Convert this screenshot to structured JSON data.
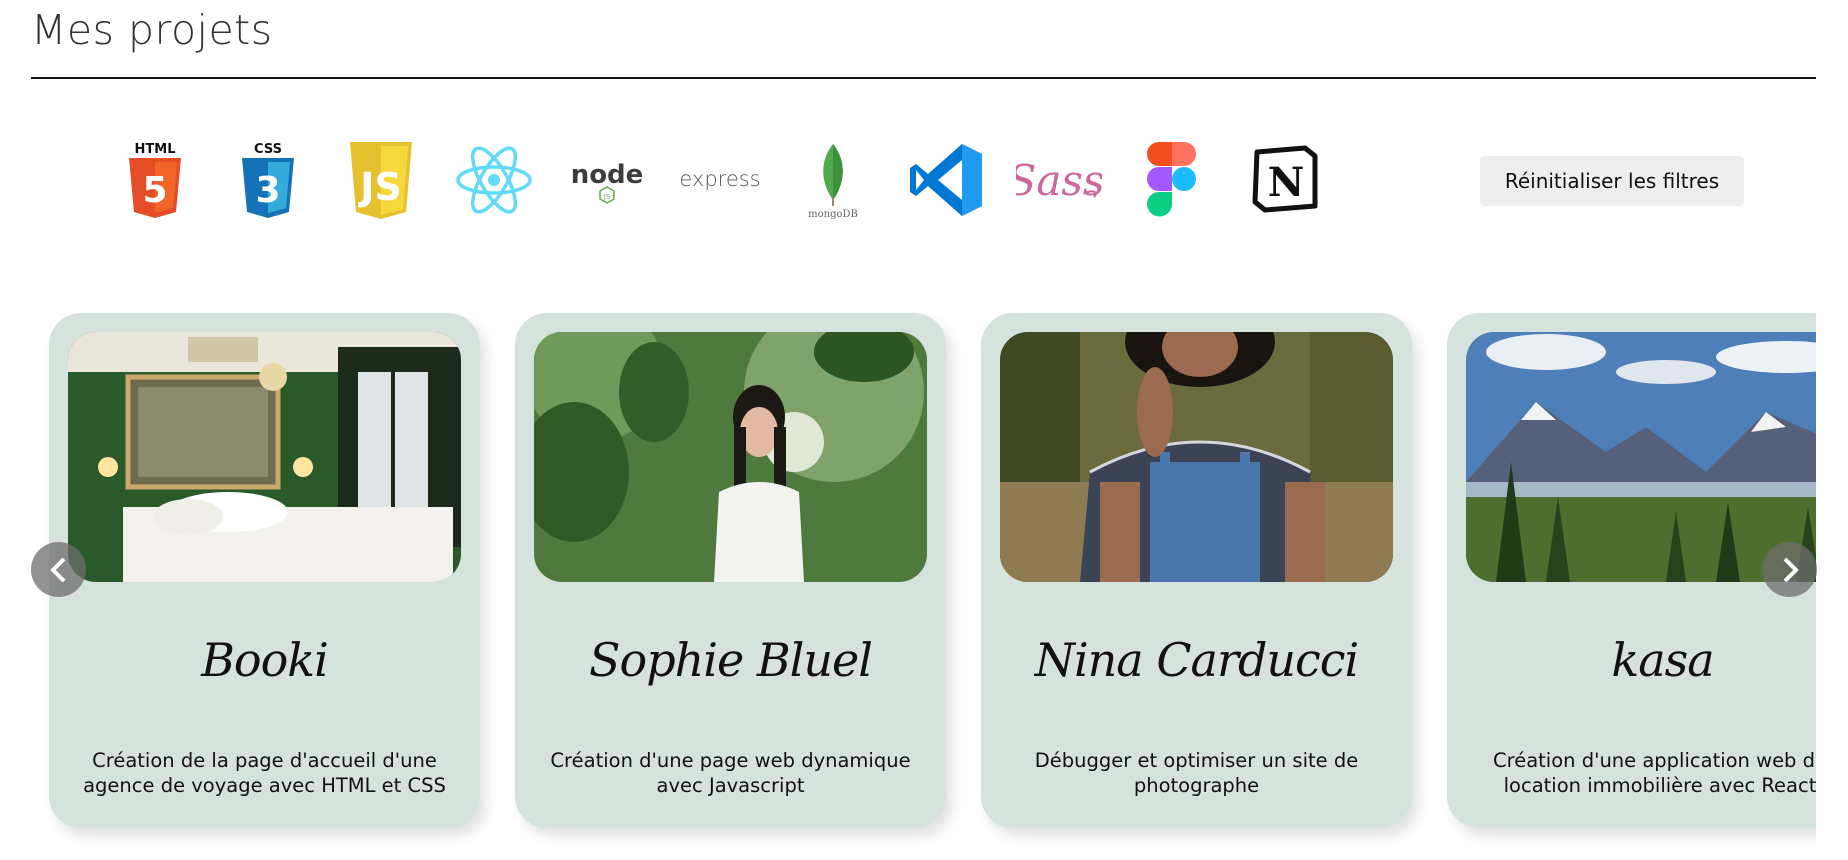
{
  "section": {
    "title": "Mes projets"
  },
  "filters": {
    "icons": [
      "html5-icon",
      "css3-icon",
      "javascript-icon",
      "react-icon",
      "nodejs-icon",
      "express-icon",
      "mongodb-icon",
      "vscode-icon",
      "sass-icon",
      "figma-icon",
      "notion-icon"
    ],
    "html_text": "HTML",
    "css_text": "CSS",
    "node_text": "node",
    "express_text": "express",
    "mongo_text": "mongoDB",
    "sass_text": "Sass",
    "notion_text": "N",
    "reset_label": "Réinitialiser les filtres"
  },
  "projects": [
    {
      "title": "Booki",
      "description_line1": "Création de la page d'accueil d'une",
      "description_line2": "agence de voyage avec HTML et CSS",
      "image": "hotel-bedroom"
    },
    {
      "title": "Sophie Bluel",
      "description_line1": "Création d'une page web dynamique",
      "description_line2": "avec Javascript",
      "image": "woman-in-forest"
    },
    {
      "title": "Nina Carducci",
      "description_line1": "Débugger et optimiser un site de",
      "description_line2": "photographe",
      "image": "woman-in-overalls"
    },
    {
      "title": "kasa",
      "description_line1": "Création d'une application web de",
      "description_line2": "location immobilière avec React",
      "image": "mountain-landscape"
    }
  ],
  "colors": {
    "card_bg": "#d6e3dc",
    "reset_bg": "#eeeeee"
  }
}
